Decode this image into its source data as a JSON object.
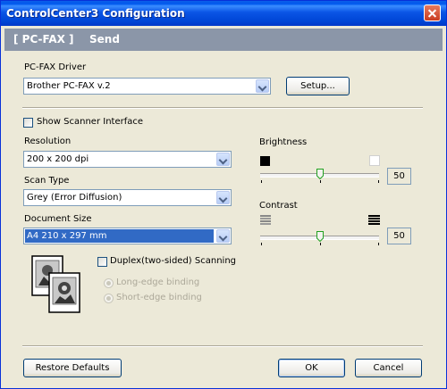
{
  "window": {
    "title": "ControlCenter3 Configuration"
  },
  "banner": {
    "left": "[ PC-FAX ]",
    "right": "Send"
  },
  "driver": {
    "label": "PC-FAX Driver",
    "value": "Brother PC-FAX v.2",
    "setup_label": "Setup..."
  },
  "scanner_interface": {
    "label": "Show Scanner Interface",
    "checked": false
  },
  "resolution": {
    "label": "Resolution",
    "value": "200 x 200 dpi"
  },
  "scan_type": {
    "label": "Scan Type",
    "value": "Grey (Error Diffusion)"
  },
  "document_size": {
    "label": "Document Size",
    "value": "A4 210 x 297 mm"
  },
  "duplex": {
    "label": "Duplex(two-sided) Scanning",
    "checked": false,
    "options": [
      "Long-edge binding",
      "Short-edge binding"
    ]
  },
  "brightness": {
    "label": "Brightness",
    "value": "50"
  },
  "contrast": {
    "label": "Contrast",
    "value": "50"
  },
  "footer": {
    "restore_label": "Restore Defaults",
    "ok_label": "OK",
    "cancel_label": "Cancel"
  },
  "colors": {
    "title_bar": "#0058ee",
    "banner": "#8b96a8",
    "selection": "#316ac5",
    "dialog": "#ece9d8"
  }
}
